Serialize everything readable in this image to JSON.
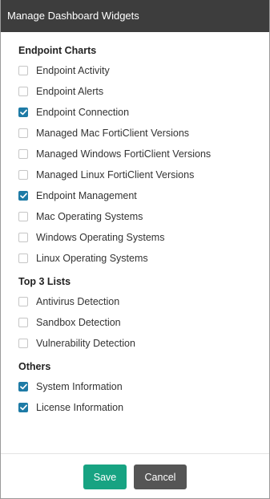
{
  "dialog": {
    "title": "Manage Dashboard Widgets"
  },
  "sections": [
    {
      "title": "Endpoint Charts",
      "items": [
        {
          "label": "Endpoint Activity",
          "checked": false
        },
        {
          "label": "Endpoint Alerts",
          "checked": false
        },
        {
          "label": "Endpoint Connection",
          "checked": true
        },
        {
          "label": "Managed Mac FortiClient Versions",
          "checked": false
        },
        {
          "label": "Managed Windows FortiClient Versions",
          "checked": false
        },
        {
          "label": "Managed Linux FortiClient Versions",
          "checked": false
        },
        {
          "label": "Endpoint Management",
          "checked": true
        },
        {
          "label": "Mac Operating Systems",
          "checked": false
        },
        {
          "label": "Windows Operating Systems",
          "checked": false
        },
        {
          "label": "Linux Operating Systems",
          "checked": false
        }
      ]
    },
    {
      "title": "Top 3 Lists",
      "items": [
        {
          "label": "Antivirus Detection",
          "checked": false
        },
        {
          "label": "Sandbox Detection",
          "checked": false
        },
        {
          "label": "Vulnerability Detection",
          "checked": false
        }
      ]
    },
    {
      "title": "Others",
      "items": [
        {
          "label": "System Information",
          "checked": true
        },
        {
          "label": "License Information",
          "checked": true
        }
      ]
    }
  ],
  "footer": {
    "save_label": "Save",
    "cancel_label": "Cancel"
  },
  "colors": {
    "titlebar_bg": "#3d3d3d",
    "checkbox_checked": "#1e7ba6",
    "save_button": "#17a382",
    "cancel_button": "#555555"
  }
}
